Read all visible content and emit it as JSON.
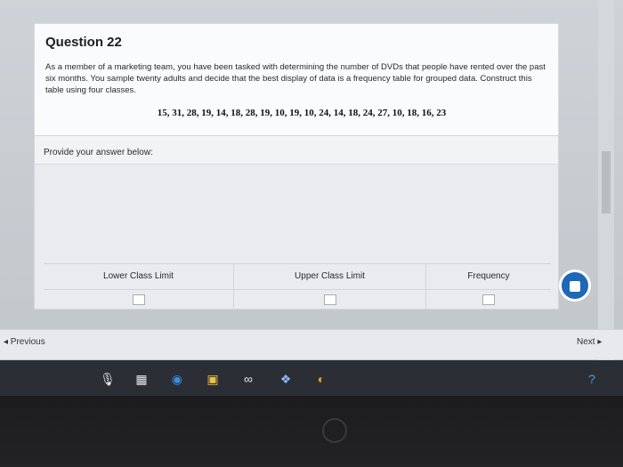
{
  "question": {
    "title": "Question 22",
    "text": "As a member of a marketing team, you have been tasked with determining the number of DVDs that people have rented over the past six months. You sample twenty adults and decide that the best display of data is a frequency table for grouped data. Construct this table using four classes.",
    "data_values": "15, 31, 28, 19, 14, 18, 28, 19, 10, 19, 10, 24, 14, 18, 24, 27, 10, 18, 16, 23"
  },
  "answer": {
    "label": "Provide your answer below:",
    "columns": [
      "Lower Class Limit",
      "Upper Class Limit",
      "Frequency"
    ]
  },
  "navigation": {
    "previous_label": "◂ Previous",
    "next_label": "Next ▸"
  },
  "taskbar": {
    "icons": [
      "microphone-icon",
      "document-icon",
      "edge-icon",
      "photos-icon",
      "infinity-icon",
      "dropbox-icon",
      "chrome-icon",
      "help-icon"
    ]
  },
  "colors": {
    "accent": "#1e68b8",
    "taskbar": "#2b2f35"
  }
}
